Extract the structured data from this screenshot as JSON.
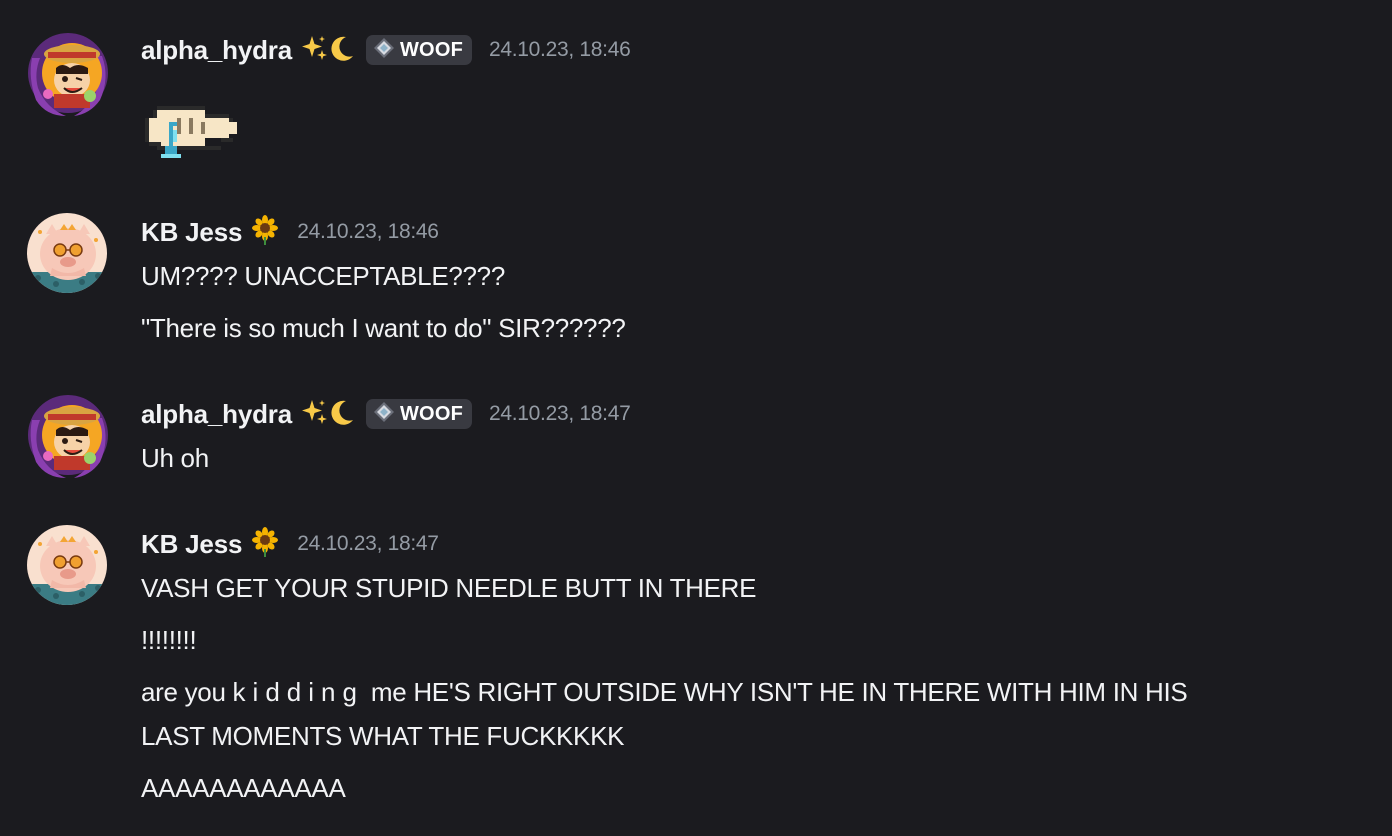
{
  "colors": {
    "background": "#1b1b1f",
    "username": "#f2f3f5",
    "timestamp": "#949ba4",
    "badge_bg": "#393a41",
    "message_text": "#f2f3f5"
  },
  "messages": [
    {
      "author": "alpha_hydra",
      "author_emoji": [
        "sparkles-icon",
        "crescent-moon-icon"
      ],
      "badge": {
        "icon": "diamond-tag-icon",
        "label": "WOOF"
      },
      "timestamp": "24.10.23, 18:46",
      "content": [],
      "sticker": "crying-hand-sticker"
    },
    {
      "author": "KB Jess",
      "author_emoji": [
        "sunflower-icon"
      ],
      "timestamp": "24.10.23, 18:46",
      "content": [
        "UM???? UNACCEPTABLE????",
        "\"There is so much I want to do\" SIR??????"
      ]
    },
    {
      "author": "alpha_hydra",
      "author_emoji": [
        "sparkles-icon",
        "crescent-moon-icon"
      ],
      "badge": {
        "icon": "diamond-tag-icon",
        "label": "WOOF"
      },
      "timestamp": "24.10.23, 18:47",
      "content": [
        "Uh oh"
      ]
    },
    {
      "author": "KB Jess",
      "author_emoji": [
        "sunflower-icon"
      ],
      "timestamp": "24.10.23, 18:47",
      "content": [
        "VASH GET YOUR STUPID NEEDLE BUTT IN THERE",
        "!!!!!!!!",
        {
          "before": "are you ",
          "spaced": "kidding",
          "after": " me HE'S RIGHT OUTSIDE WHY ISN'T HE IN THERE WITH HIM IN HIS"
        },
        "LAST MOMENTS WHAT THE FUCKKKKK",
        "AAAAAAAAAAAA"
      ]
    }
  ]
}
